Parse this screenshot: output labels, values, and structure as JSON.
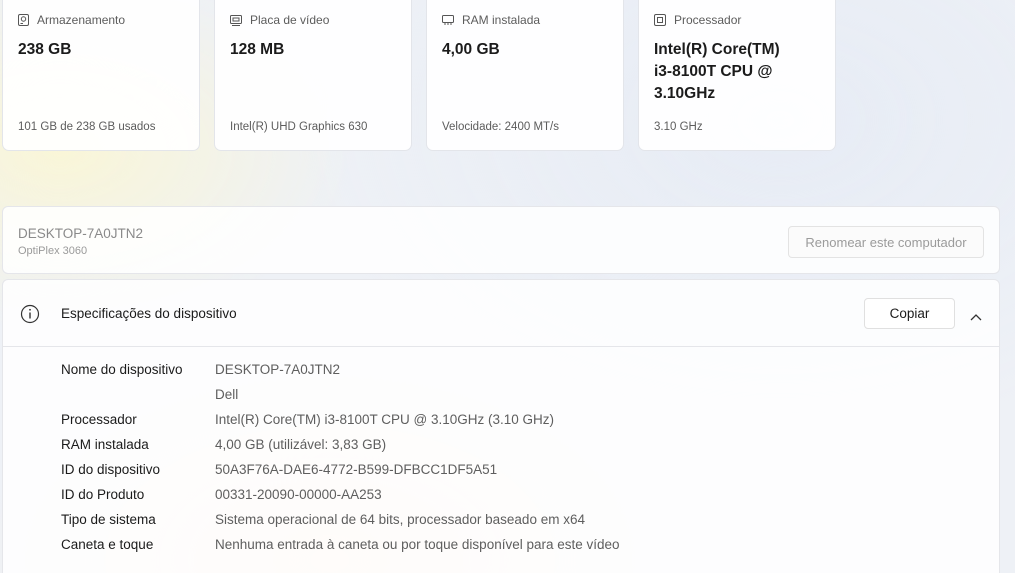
{
  "cards": [
    {
      "icon": "storage-icon",
      "label": "Armazenamento",
      "value": "238 GB",
      "sub": "101 GB de 238 GB usados"
    },
    {
      "icon": "video-card-icon",
      "label": "Placa de vídeo",
      "value": "128 MB",
      "sub": "Intel(R) UHD Graphics 630"
    },
    {
      "icon": "ram-icon",
      "label": "RAM instalada",
      "value": "4,00 GB",
      "sub": "Velocidade: 2400 MT/s"
    },
    {
      "icon": "processor-icon",
      "label": "Processador",
      "value_lines": [
        "Intel(R) Core(TM)",
        "i3-8100T CPU @",
        "3.10GHz"
      ],
      "sub": "3.10 GHz"
    }
  ],
  "pc": {
    "name": "DESKTOP-7A0JTN2",
    "model": "OptiPlex 3060",
    "rename_label": "Renomear este computador"
  },
  "specs": {
    "title": "Especificações do dispositivo",
    "copy_label": "Copiar",
    "rows": [
      {
        "key": "Nome do dispositivo",
        "value": "DESKTOP-7A0JTN2"
      },
      {
        "key": "",
        "value": "Dell"
      },
      {
        "key": "Processador",
        "value": "Intel(R) Core(TM) i3-8100T CPU @ 3.10GHz (3.10 GHz)"
      },
      {
        "key": "RAM instalada",
        "value": "4,00 GB (utilizável: 3,83 GB)"
      },
      {
        "key": "ID do dispositivo",
        "value": "50A3F76A-DAE6-4772-B599-DFBCC1DF5A51"
      },
      {
        "key": "ID do Produto",
        "value": "00331-20090-00000-AA253"
      },
      {
        "key": "Tipo de sistema",
        "value": "Sistema operacional de 64 bits, processador baseado em x64"
      },
      {
        "key": "Caneta e toque",
        "value": "Nenhuma entrada à caneta ou por toque disponível para este vídeo"
      }
    ]
  }
}
